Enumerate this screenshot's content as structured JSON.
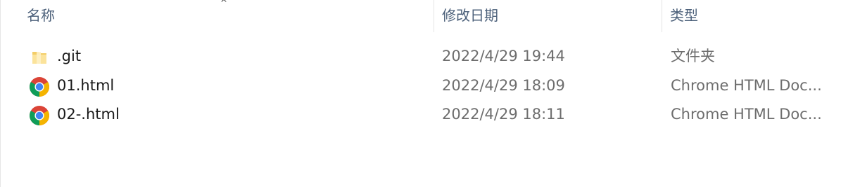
{
  "columns": {
    "name": "名称",
    "date_modified": "修改日期",
    "type": "类型"
  },
  "sort_indicator": "^",
  "files": [
    {
      "name": ".git",
      "date": "2022/4/29 19:44",
      "type": "文件夹",
      "icon": "folder-icon"
    },
    {
      "name": "01.html",
      "date": "2022/4/29 18:09",
      "type": "Chrome HTML Doc...",
      "icon": "chrome-icon"
    },
    {
      "name": "02-.html",
      "date": "2022/4/29 18:11",
      "type": "Chrome HTML Doc...",
      "icon": "chrome-icon"
    }
  ],
  "colors": {
    "header_text": "#4c607a",
    "folder": "#f8d775",
    "chrome_red": "#db4437",
    "chrome_green": "#0f9d58",
    "chrome_yellow": "#f4b400",
    "chrome_blue": "#4285f4"
  }
}
